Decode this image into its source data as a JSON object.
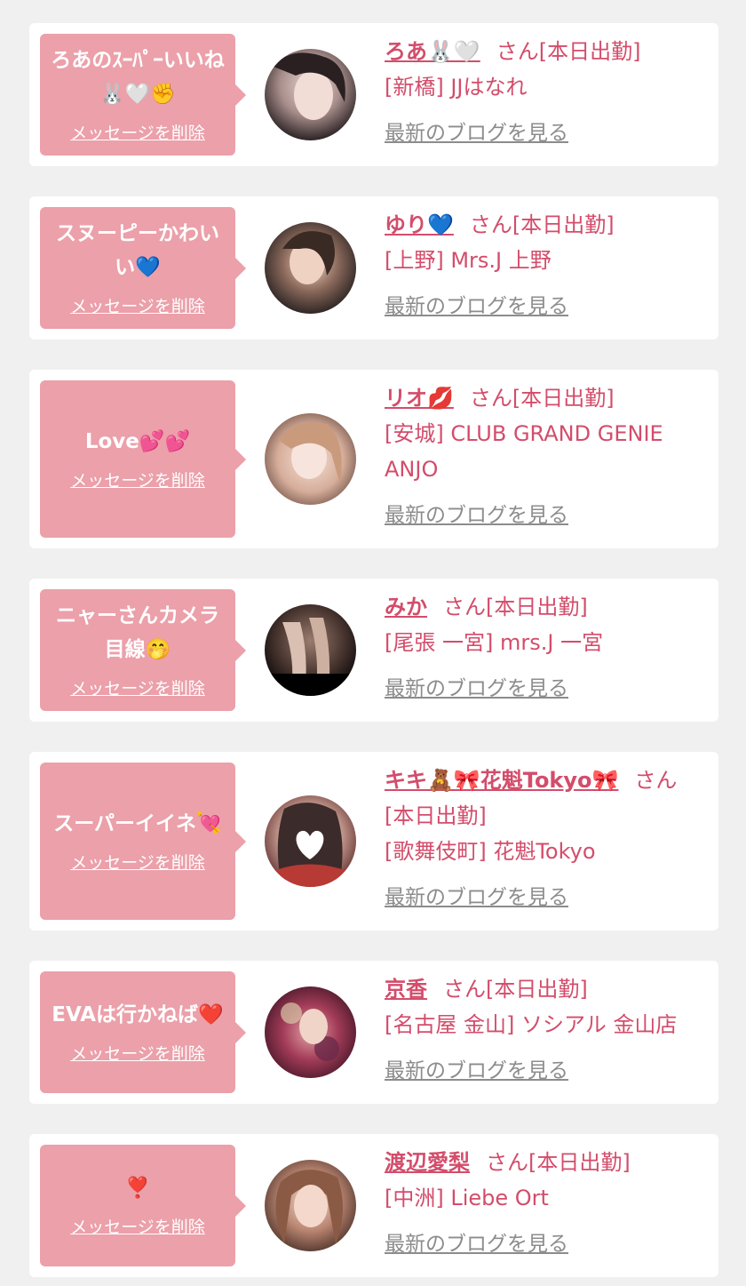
{
  "delete_label": "メッセージを削除",
  "blog_label": "最新のブログを見る",
  "colors": {
    "background": "#f0f0f0",
    "card": "#ffffff",
    "bubble": "#eba0aa",
    "accent": "#d34d6b",
    "link_gray": "#8c8c8c"
  },
  "items": [
    {
      "message": "ろあのｽｰﾊﾟｰいいね🐰🤍✊",
      "name": "ろあ🐰🤍",
      "status": "さん[本日出勤]",
      "shop": "[新橋] JJはなれ"
    },
    {
      "message": "スヌーピーかわいい💙",
      "name": "ゆり💙",
      "status": "さん[本日出勤]",
      "shop": "[上野] Mrs.J 上野"
    },
    {
      "message": "Love💕💕",
      "name": "リオ💋",
      "status": "さん[本日出勤]",
      "shop": "[安城] CLUB GRAND GENIE ANJO"
    },
    {
      "message": "ニャーさんカメラ目線🤭",
      "name": "みか",
      "status": "さん[本日出勤]",
      "shop": "[尾張 一宮] mrs.J 一宮"
    },
    {
      "message": "スーパーイイネ💘",
      "name": "キキ🧸🎀花魁Tokyo🎀",
      "status": "さん[本日出勤]",
      "shop": "[歌舞伎町] 花魁Tokyo"
    },
    {
      "message": "EVAは行かねば❤️",
      "name": "京香",
      "status": "さん[本日出勤]",
      "shop": "[名古屋 金山] ソシアル 金山店"
    },
    {
      "message": "❣️",
      "name": "渡辺愛梨",
      "status": "さん[本日出勤]",
      "shop": "[中洲] Liebe Ort"
    }
  ]
}
